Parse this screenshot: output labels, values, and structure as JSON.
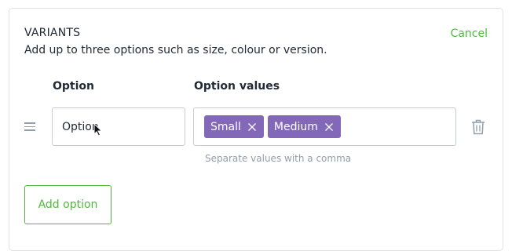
{
  "variants": {
    "title": "VARIANTS",
    "description": "Add up to three options such as size, colour or version.",
    "cancel_label": "Cancel"
  },
  "columns": {
    "option_label": "Option",
    "values_label": "Option values"
  },
  "option_row": {
    "option_value": "Option",
    "tags": [
      "Small",
      "Medium"
    ],
    "values_hint": "Separate values with a comma"
  },
  "add_option_label": "Add option",
  "colors": {
    "accent_green": "#50b83c",
    "tag_purple": "#8367b8",
    "border": "#c4cdd5",
    "muted_text": "#919eab"
  },
  "icons": {
    "drag": "drag-handle-icon",
    "remove_tag": "close-icon",
    "delete": "trash-icon"
  }
}
